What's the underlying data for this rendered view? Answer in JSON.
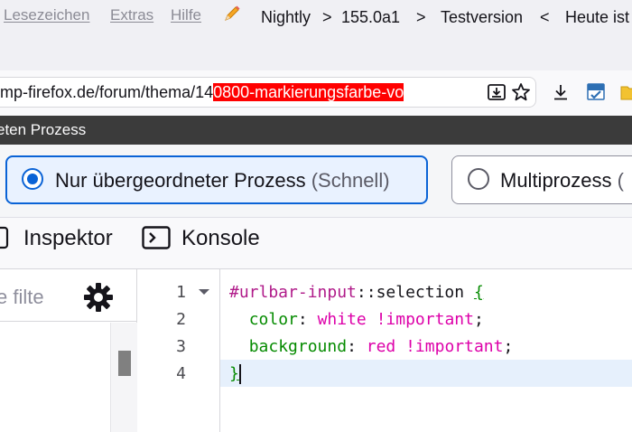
{
  "menu": {
    "items": [
      "Lesezeichen",
      "Extras",
      "Hilfe"
    ],
    "title_info": {
      "channel": "Nightly",
      "sep1": ">",
      "version": "155.0a1",
      "sep2": ">",
      "status": "Testversion",
      "sep3": "<",
      "today": "Heute ist"
    }
  },
  "urlbar": {
    "text_before": "mp-firefox.de/forum/thema/14",
    "text_selected": "0800-markierungsfarbe-vo"
  },
  "dialog": {
    "title_fragment": "eten Prozess",
    "option1_label": "Nur übergeordneter Prozess",
    "option1_hint": "(Schnell)",
    "option2_label": "Multiprozess",
    "option2_hint": "("
  },
  "tools": {
    "inspector_label": "Inspektor",
    "console_label": "Konsole"
  },
  "sidebar": {
    "filter_placeholder": "e filte"
  },
  "editor": {
    "line_numbers": [
      "1",
      "2",
      "3",
      "4"
    ],
    "line1": {
      "selector": "#urlbar-input",
      "pseudo": "::selection",
      "brace": "{"
    },
    "line2": {
      "indent": "  ",
      "prop": "color",
      "colon": ": ",
      "value": "white !important",
      "semi": ";"
    },
    "line3": {
      "indent": "  ",
      "prop": "background",
      "colon": ": ",
      "value": "red !important",
      "semi": ";"
    },
    "line4": {
      "brace": "}"
    }
  },
  "colors": {
    "accent": "#0a63d6",
    "url_selection_bg": "#ff0000",
    "url_selection_text": "#ffffff",
    "css_property": "#058b00",
    "css_value": "#dd00a9",
    "css_selector": "#b01a89",
    "active_line_bg": "#e6f0fc"
  },
  "icons": [
    "pencil-icon",
    "save-page-icon",
    "bookmark-star-icon",
    "download-icon",
    "w3c-validator-icon",
    "folder-icon",
    "inspector-icon",
    "console-icon",
    "gear-icon",
    "fold-arrow-icon"
  ]
}
